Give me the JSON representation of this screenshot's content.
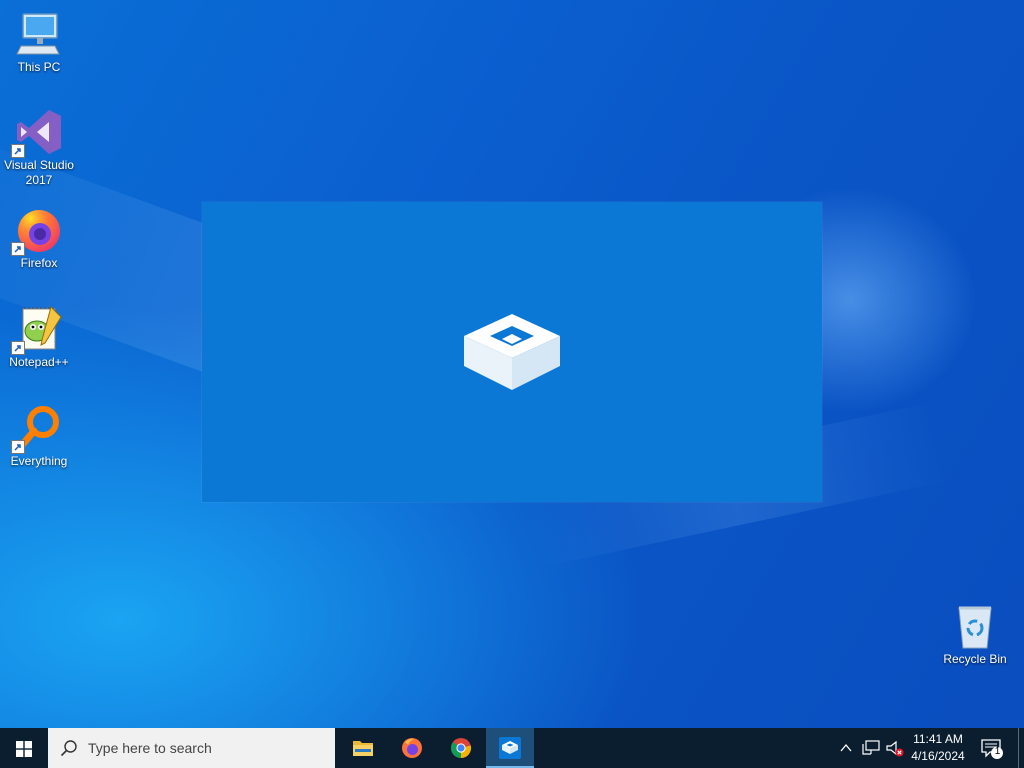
{
  "desktop": {
    "icons": [
      {
        "label": "This PC",
        "icon": "computer-icon"
      },
      {
        "label": "Visual Studio 2017",
        "icon": "visual-studio-icon"
      },
      {
        "label": "Firefox",
        "icon": "firefox-icon"
      },
      {
        "label": "Notepad++",
        "icon": "notepadpp-icon"
      },
      {
        "label": "Everything",
        "icon": "everything-icon"
      },
      {
        "label": "Recycle Bin",
        "icon": "recycle-bin-icon"
      }
    ]
  },
  "splash": {
    "icon": "sandbox-box-icon"
  },
  "taskbar": {
    "search_placeholder": "Type here to search",
    "apps": [
      {
        "icon": "file-explorer-icon"
      },
      {
        "icon": "firefox-icon"
      },
      {
        "icon": "chrome-icon"
      },
      {
        "icon": "sandbox-icon",
        "active": true
      }
    ],
    "tray": {
      "time": "11:41 AM",
      "date": "4/16/2024",
      "notification_count": "1"
    }
  },
  "colors": {
    "splash_bg": "#0b78d6",
    "taskbar_bg": "#0b1e2f",
    "search_bg": "#f1f1f1",
    "active_app_highlight": "#1e4f7a"
  }
}
